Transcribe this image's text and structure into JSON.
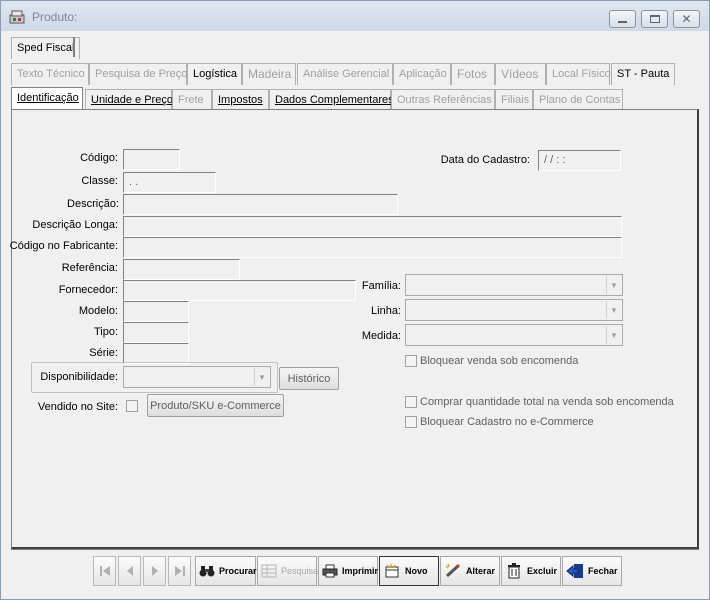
{
  "window": {
    "title": "Produto:",
    "icon": "product-app-icon",
    "controls": [
      "minimize-icon",
      "maximize-icon",
      "close-icon"
    ]
  },
  "tabs_row1": [
    {
      "label": "Sped Fiscal",
      "state": "normal"
    }
  ],
  "tabs_row2": [
    {
      "label": "Texto Técnico",
      "state": "disabled"
    },
    {
      "label": "Pesquisa de Preço",
      "state": "disabled"
    },
    {
      "label": "Logística",
      "state": "normal"
    },
    {
      "label": "Madeira",
      "state": "disabled"
    },
    {
      "label": "Análise Gerencial",
      "state": "disabled"
    },
    {
      "label": "Aplicação",
      "state": "disabled"
    },
    {
      "label": "Fotos",
      "state": "disabled"
    },
    {
      "label": "Vídeos",
      "state": "disabled"
    },
    {
      "label": "Local Físico",
      "state": "disabled"
    },
    {
      "label": "ST - Pauta",
      "state": "normal"
    }
  ],
  "tabs_row3": [
    {
      "label": "Identificação",
      "state": "active"
    },
    {
      "label": "Unidade e Preço",
      "state": "normal"
    },
    {
      "label": "Frete",
      "state": "disabled"
    },
    {
      "label": "Impostos",
      "state": "normal"
    },
    {
      "label": "Dados Complementares",
      "state": "normal"
    },
    {
      "label": "Outras Referências",
      "state": "disabled"
    },
    {
      "label": "Filiais",
      "state": "disabled"
    },
    {
      "label": "Plano de Contas",
      "state": "disabled"
    }
  ],
  "form": {
    "codigo": {
      "label": "Código:",
      "value": ""
    },
    "classe": {
      "label": "Classe:",
      "value": ". ."
    },
    "descricao": {
      "label": "Descrição:",
      "value": ""
    },
    "descricao_longa": {
      "label": "Descrição Longa:",
      "value": ""
    },
    "codigo_fabricante": {
      "label": "Código no Fabricante:",
      "value": ""
    },
    "referencia": {
      "label": "Referência:",
      "value": ""
    },
    "fornecedor": {
      "label": "Fornecedor:",
      "value": ""
    },
    "modelo": {
      "label": "Modelo:",
      "value": ""
    },
    "tipo": {
      "label": "Tipo:",
      "value": ""
    },
    "serie": {
      "label": "Série:",
      "value": ""
    },
    "data_cadastro": {
      "label": "Data do Cadastro:",
      "value": "/ /    : :"
    },
    "familia": {
      "label": "Família:",
      "value": ""
    },
    "linha": {
      "label": "Linha:",
      "value": ""
    },
    "medida": {
      "label": "Medida:",
      "value": ""
    },
    "disponibilidade": {
      "label": "Disponibilidade:",
      "value": ""
    },
    "historico_button": "Histórico",
    "vendido_no_site": {
      "label": "Vendido no Site:",
      "checked": false
    },
    "produto_sku_button": "Produto/SKU e-Commerce",
    "bloquear_venda_encomenda": {
      "label": "Bloquear venda sob encomenda",
      "checked": false
    },
    "comprar_quantidade_total": {
      "label": "Comprar quantidade total na venda sob encomenda",
      "checked": false
    },
    "bloquear_cadastro_ecommerce": {
      "label": "Bloquear Cadastro no e-Commerce",
      "checked": false
    }
  },
  "toolbar": {
    "first_icon": "first-record-icon",
    "prev_icon": "previous-record-icon",
    "next_icon": "next-record-icon",
    "last_icon": "last-record-icon",
    "procurar": {
      "label": "Procurar",
      "icon": "binoculars-icon"
    },
    "pesquisa": {
      "label": "Pesquisa",
      "icon": "grid-search-icon"
    },
    "imprimir": {
      "label": "Imprimir",
      "icon": "printer-icon"
    },
    "novo": {
      "label": "Novo",
      "icon": "new-record-icon"
    },
    "alterar": {
      "label": "Alterar",
      "icon": "edit-pencil-icon"
    },
    "excluir": {
      "label": "Excluir",
      "icon": "trash-icon"
    },
    "fechar": {
      "label": "Fechar",
      "icon": "exit-door-icon"
    }
  }
}
